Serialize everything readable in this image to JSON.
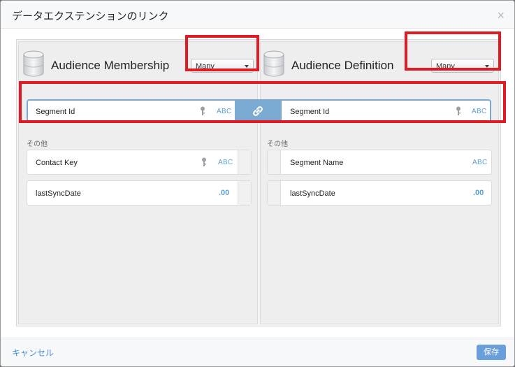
{
  "dialog": {
    "title": "データエクステンションのリンク",
    "close_glyph": "×"
  },
  "left": {
    "title": "Audience Membership",
    "cardinality": "Many",
    "linked_field": {
      "name": "Segment Id",
      "type": "ABC",
      "primary_key": true
    },
    "other_label": "その他",
    "fields": [
      {
        "name": "Contact Key",
        "type": "ABC",
        "primary_key": true
      },
      {
        "name": "lastSyncDate",
        "type": ".00",
        "primary_key": false
      }
    ]
  },
  "right": {
    "title": "Audience Definition",
    "cardinality": "Many",
    "linked_field": {
      "name": "Segment Id",
      "type": "ABC",
      "primary_key": true
    },
    "other_label": "その他",
    "fields": [
      {
        "name": "Segment Name",
        "type": "ABC",
        "primary_key": false
      },
      {
        "name": "lastSyncDate",
        "type": ".00",
        "primary_key": false
      }
    ]
  },
  "link_icon": "chain-link-icon",
  "footer": {
    "cancel": "キャンセル",
    "save": "保存"
  },
  "colors": {
    "accent": "#7aaad2",
    "type_text": "#5a9fd4",
    "highlight": "#e01b24",
    "save_button": "#6b9fdb"
  }
}
